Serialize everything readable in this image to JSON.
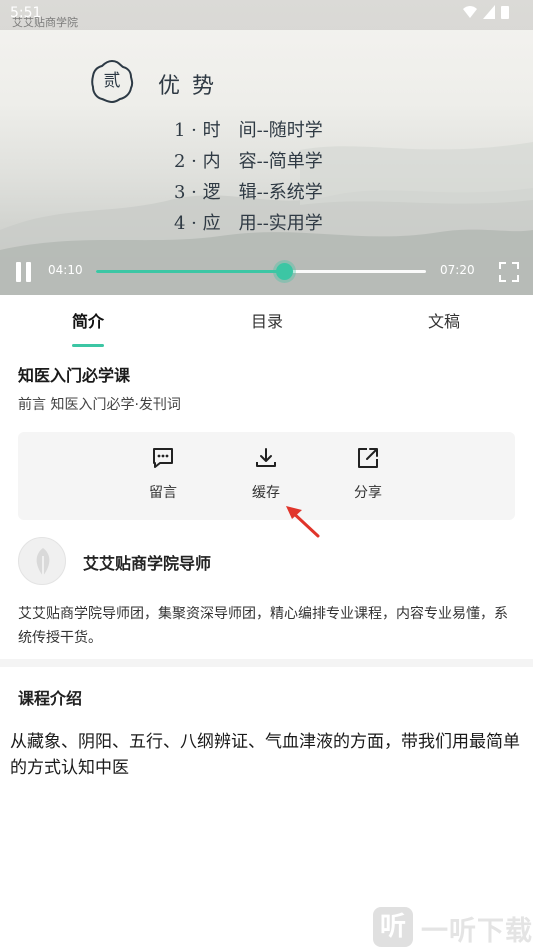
{
  "status_bar": {
    "time": "5:51",
    "logo_text": "艾艾贴商学院"
  },
  "slide": {
    "seal_char": "贰",
    "heading": "优势",
    "lines": [
      "1 · 时　间--随时学",
      "2 · 内　容--简单学",
      "3 · 逻　辑--系统学",
      "4 · 应　用--实用学"
    ]
  },
  "player": {
    "current_time": "04:10",
    "total_time": "07:20",
    "progress": 0.57,
    "accent_color": "#3cc6a4"
  },
  "tabs": [
    {
      "label": "简介",
      "active": true
    },
    {
      "label": "目录",
      "active": false
    },
    {
      "label": "文稿",
      "active": false
    }
  ],
  "course": {
    "title": "知医入门必学课",
    "subtitle": "前言 知医入门必学·发刊词"
  },
  "actions": [
    {
      "label": "留言",
      "icon": "comment-icon"
    },
    {
      "label": "缓存",
      "icon": "download-icon"
    },
    {
      "label": "分享",
      "icon": "share-icon"
    }
  ],
  "author": {
    "name": "艾艾贴商学院导师",
    "description": "艾艾贴商学院导师团，集聚资深导师团，精心编排专业课程，内容专业易懂，系统传授干货。"
  },
  "intro": {
    "title": "课程介绍",
    "body": "从藏象、阴阳、五行、八纲辨证、气血津液的方面，带我们用最简单的方式认知中医"
  },
  "watermark": {
    "glyph": "听",
    "text": "一听下载"
  }
}
